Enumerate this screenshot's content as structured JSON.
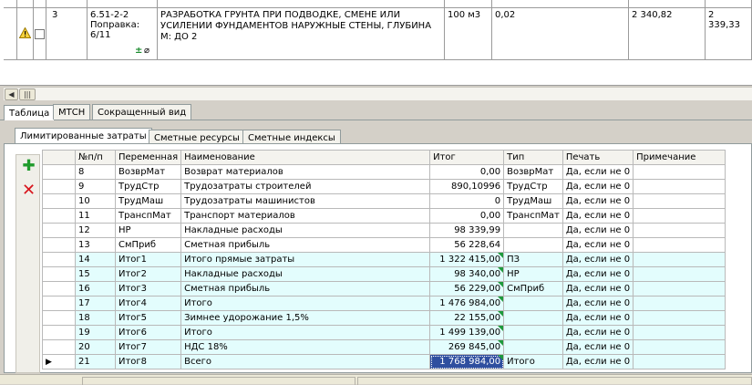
{
  "top_row": {
    "index": "3",
    "code": "6.51-2-2\nПоправка:\n6/11",
    "name": "РАЗРАБОТКА ГРУНТА ПРИ ПОДВОДКЕ, СМЕНЕ ИЛИ УСИЛЕНИИ ФУНДАМЕНТОВ НАРУЖНЫЕ СТЕНЫ, ГЛУБИНА М: ДО 2",
    "unit": "100 м3",
    "qty": "0,02",
    "total1": "2 340,82",
    "total2": "2 339,33"
  },
  "view_tabs": [
    "Таблица",
    "МТСН",
    "Сокращенный вид"
  ],
  "sub_tabs": [
    "Лимитированные затраты",
    "Сметные ресурсы",
    "Сметные индексы"
  ],
  "columns": [
    "№п/п",
    "Переменная",
    "Наименование",
    "Итог",
    "Тип",
    "Печать",
    "Примечание"
  ],
  "rows": [
    {
      "n": "8",
      "var": "ВозврМат",
      "name": "Возврат материалов",
      "total": "0,00",
      "type": "ВозврМат",
      "print": "Да, если не 0",
      "note": "",
      "hl": false,
      "mark": false
    },
    {
      "n": "9",
      "var": "ТрудСтр",
      "name": "Трудозатраты строителей",
      "total": "890,10996",
      "type": "ТрудСтр",
      "print": "Да, если не 0",
      "note": "",
      "hl": false,
      "mark": false
    },
    {
      "n": "10",
      "var": "ТрудМаш",
      "name": "Трудозатраты машинистов",
      "total": "0",
      "type": "ТрудМаш",
      "print": "Да, если не 0",
      "note": "",
      "hl": false,
      "mark": false
    },
    {
      "n": "11",
      "var": "ТранспМат",
      "name": "Транспорт материалов",
      "total": "0,00",
      "type": "ТранспМат",
      "print": "Да, если не 0",
      "note": "",
      "hl": false,
      "mark": false
    },
    {
      "n": "12",
      "var": "НР",
      "name": "Накладные расходы",
      "total": "98 339,99",
      "type": "",
      "print": "Да, если не 0",
      "note": "",
      "hl": false,
      "mark": false
    },
    {
      "n": "13",
      "var": "СмПриб",
      "name": "Сметная прибыль",
      "total": "56 228,64",
      "type": "",
      "print": "Да, если не 0",
      "note": "",
      "hl": false,
      "mark": false
    },
    {
      "n": "14",
      "var": "Итог1",
      "name": "Итого прямые затраты",
      "total": "1 322 415,00",
      "type": "ПЗ",
      "print": "Да, если не 0",
      "note": "",
      "hl": true,
      "mark": true
    },
    {
      "n": "15",
      "var": "Итог2",
      "name": "Накладные расходы",
      "total": "98 340,00",
      "type": "НР",
      "print": "Да, если не 0",
      "note": "",
      "hl": true,
      "mark": true
    },
    {
      "n": "16",
      "var": "Итог3",
      "name": "Сметная прибыль",
      "total": "56 229,00",
      "type": "СмПриб",
      "print": "Да, если не 0",
      "note": "",
      "hl": true,
      "mark": true
    },
    {
      "n": "17",
      "var": "Итог4",
      "name": "Итого",
      "total": "1 476 984,00",
      "type": "",
      "print": "Да, если не 0",
      "note": "",
      "hl": true,
      "mark": true
    },
    {
      "n": "18",
      "var": "Итог5",
      "name": "Зимнее удорожание 1,5%",
      "total": "22 155,00",
      "type": "",
      "print": "Да, если не 0",
      "note": "",
      "hl": true,
      "mark": true
    },
    {
      "n": "19",
      "var": "Итог6",
      "name": "Итого",
      "total": "1 499 139,00",
      "type": "",
      "print": "Да, если не 0",
      "note": "",
      "hl": true,
      "mark": true
    },
    {
      "n": "20",
      "var": "Итог7",
      "name": "НДС 18%",
      "total": "269 845,00",
      "type": "",
      "print": "Да, если не 0",
      "note": "",
      "hl": true,
      "mark": true
    },
    {
      "n": "21",
      "var": "Итог8",
      "name": "Всего",
      "total": "1 768 984,00",
      "type": "Итого",
      "print": "Да, если не 0",
      "note": "",
      "hl": true,
      "mark": true,
      "current": true
    }
  ],
  "icons": {
    "warning": "warning-icon",
    "add": "add-row-icon",
    "delete": "delete-row-icon",
    "pointer": "row-pointer-icon"
  }
}
